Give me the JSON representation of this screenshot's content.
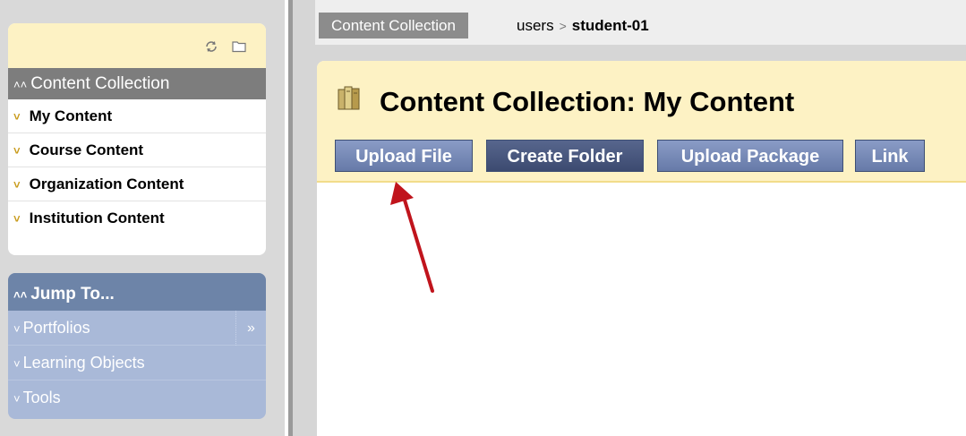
{
  "sidebar": {
    "toolbar_icons": [
      "refresh-icon",
      "folder-icon"
    ],
    "content_collection": {
      "header": "Content Collection",
      "items": [
        {
          "label": "My Content"
        },
        {
          "label": "Course Content"
        },
        {
          "label": "Organization Content"
        },
        {
          "label": "Institution Content"
        }
      ]
    },
    "jump_to": {
      "header": "Jump To...",
      "items": [
        {
          "label": "Portfolios",
          "expand": "»"
        },
        {
          "label": "Learning Objects"
        },
        {
          "label": "Tools"
        }
      ]
    }
  },
  "breadcrumb": {
    "root": "Content Collection",
    "parent": "users",
    "separator": ">",
    "current": "student-01"
  },
  "main": {
    "title": "Content Collection: My Content",
    "buttons": {
      "upload_file": "Upload File",
      "create_folder": "Create Folder",
      "upload_package": "Upload Package",
      "link": "Link"
    }
  },
  "colors": {
    "accent_yellow": "#fdf2c4",
    "button_blue": "#667aa8",
    "button_dark": "#3c4a70",
    "annotation_arrow": "#c0141c"
  }
}
